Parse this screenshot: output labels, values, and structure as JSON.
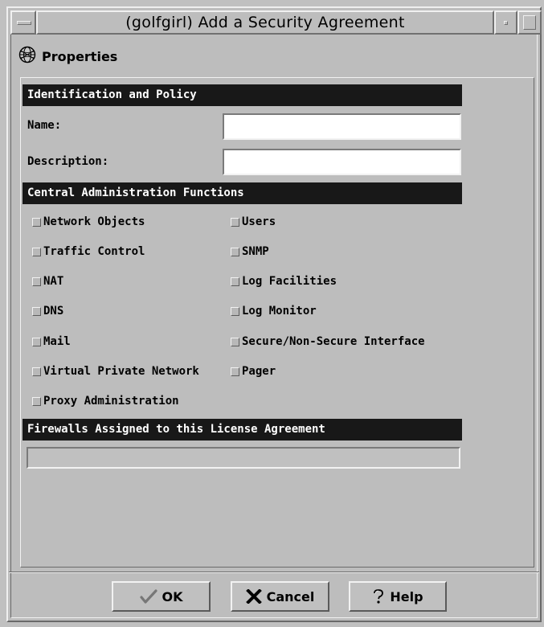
{
  "window": {
    "title": "(golfgirl) Add a Security Agreement"
  },
  "properties": {
    "label": "Properties",
    "icon": "properties-globe-icon"
  },
  "identification": {
    "header": "Identification and Policy",
    "name_label": "Name:",
    "name_value": "",
    "description_label": "Description:",
    "description_value": ""
  },
  "central_admin": {
    "header": "Central Administration Functions",
    "left": [
      {
        "label": "Network Objects",
        "checked": false
      },
      {
        "label": "Traffic Control",
        "checked": false
      },
      {
        "label": "NAT",
        "checked": false
      },
      {
        "label": "DNS",
        "checked": false
      },
      {
        "label": "Mail",
        "checked": false
      },
      {
        "label": "Virtual Private Network",
        "checked": false
      },
      {
        "label": "Proxy Administration",
        "checked": false
      }
    ],
    "right": [
      {
        "label": "Users",
        "checked": false
      },
      {
        "label": "SNMP",
        "checked": false
      },
      {
        "label": "Log Facilities",
        "checked": false
      },
      {
        "label": "Log Monitor",
        "checked": false
      },
      {
        "label": "Secure/Non-Secure Interface",
        "checked": false
      },
      {
        "label": "Pager",
        "checked": false
      }
    ]
  },
  "firewalls": {
    "header": "Firewalls Assigned to this License Agreement",
    "items": []
  },
  "buttons": {
    "ok": {
      "label": "OK",
      "icon": "checkmark-icon"
    },
    "cancel": {
      "label": "Cancel",
      "icon": "x-icon"
    },
    "help": {
      "label": "Help",
      "icon": "question-icon"
    }
  }
}
